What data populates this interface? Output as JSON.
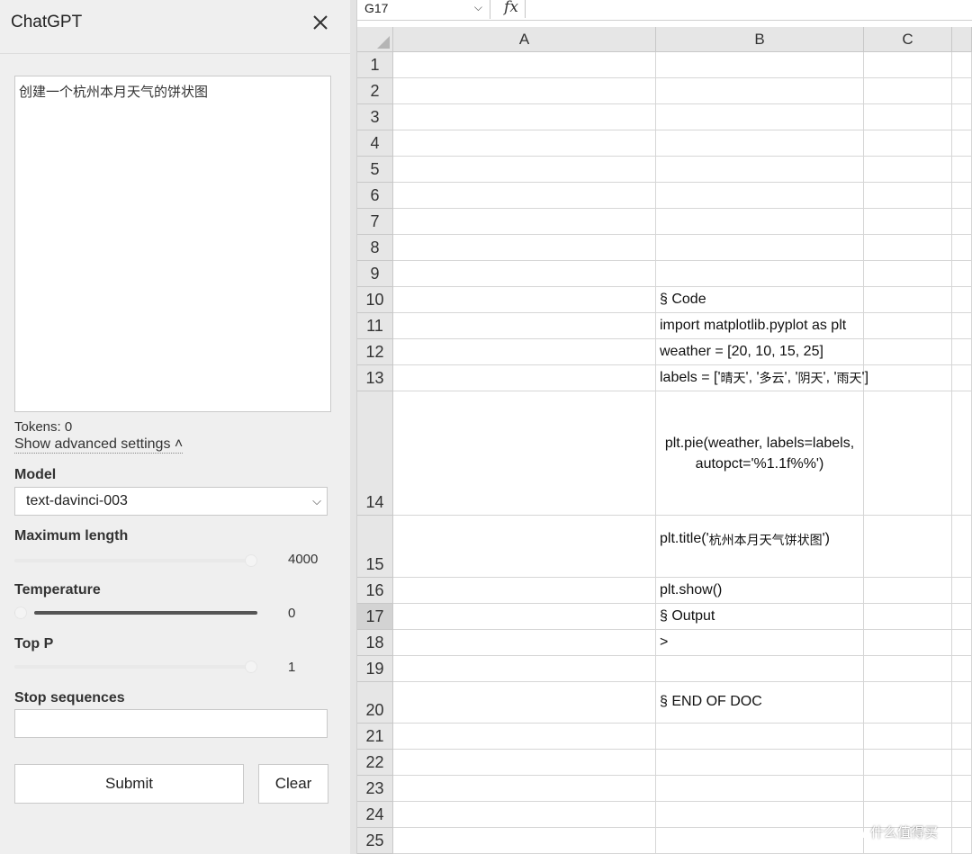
{
  "panel": {
    "title": "ChatGPT",
    "prompt_text": "创建一个杭州本月天气的饼状图",
    "tokens_text": "Tokens: 0",
    "advanced_settings_label": "Show advanced settings ˄",
    "model_label": "Model",
    "model_value": "text-davinci-003",
    "max_length_label": "Maximum length",
    "max_length_value": "4000",
    "max_length_level": 1.0,
    "temperature_label": "Temperature",
    "temperature_value": "0",
    "temperature_level": 0.0,
    "top_p_label": "Top P",
    "top_p_value": "1",
    "top_p_level": 1.0,
    "stop_sequences_label": "Stop sequences",
    "stop_sequences_value": "",
    "submit_label": "Submit",
    "clear_label": "Clear"
  },
  "sheet": {
    "name_box": "G17",
    "fx_label": "fx",
    "columns": [
      "A",
      "B",
      "C"
    ],
    "selected_row": 17,
    "rows": [
      {
        "num": "1",
        "b": ""
      },
      {
        "num": "2",
        "b": ""
      },
      {
        "num": "3",
        "b": ""
      },
      {
        "num": "4",
        "b": ""
      },
      {
        "num": "5",
        "b": ""
      },
      {
        "num": "6",
        "b": ""
      },
      {
        "num": "7",
        "b": ""
      },
      {
        "num": "8",
        "b": ""
      },
      {
        "num": "9",
        "b": ""
      },
      {
        "num": "10",
        "b": "§ Code"
      },
      {
        "num": "11",
        "b": "import matplotlib.pyplot as plt"
      },
      {
        "num": "12",
        "b": "weather = [20, 10, 15, 25]"
      },
      {
        "num": "13",
        "b_parts": [
          "labels = ['",
          "晴天",
          "', '",
          "多云",
          "', '",
          "阴天",
          "', '",
          "雨天",
          "']"
        ]
      },
      {
        "num": "14",
        "b": "plt.pie(weather, labels=labels, autopct='%1.1f%%')"
      },
      {
        "num": "15",
        "b_parts": [
          "plt.title('",
          "杭州本月天气饼状图",
          "')"
        ]
      },
      {
        "num": "16",
        "b": "plt.show()"
      },
      {
        "num": "17",
        "b": "§ Output"
      },
      {
        "num": "18",
        "b": ">"
      },
      {
        "num": "19",
        "b": ""
      },
      {
        "num": "20",
        "b": "§ END OF DOC"
      },
      {
        "num": "21",
        "b": ""
      },
      {
        "num": "22",
        "b": ""
      },
      {
        "num": "23",
        "b": ""
      },
      {
        "num": "24",
        "b": ""
      },
      {
        "num": "25",
        "b": ""
      }
    ]
  },
  "watermark": "什么值得买",
  "colors": {
    "panel_bg": "#efefef",
    "header_bg": "#e6e6e6",
    "selected_header_bg": "#d3d3d3",
    "slider_fill": "#555555"
  }
}
